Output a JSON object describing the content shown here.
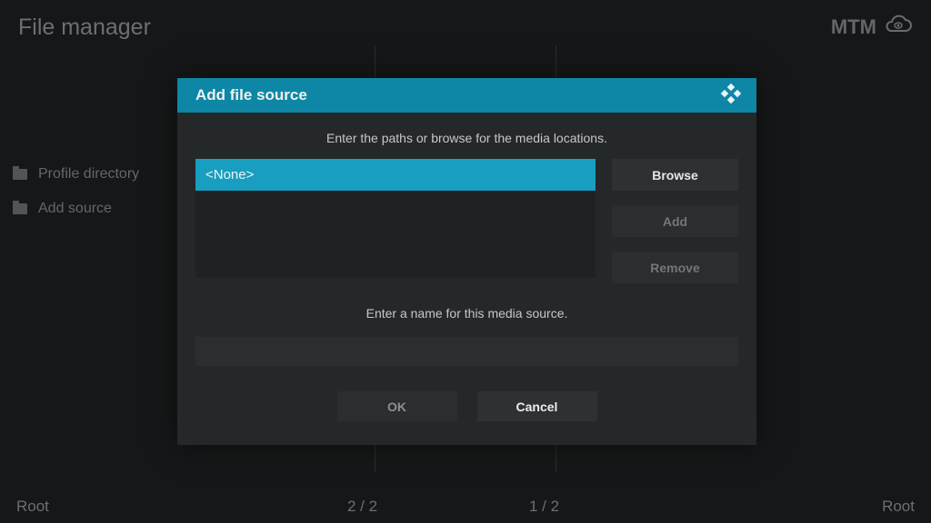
{
  "header": {
    "title": "File manager",
    "mtm": "MTM"
  },
  "sidebar": {
    "items": [
      {
        "label": "Profile directory"
      },
      {
        "label": "Add source"
      }
    ]
  },
  "footer": {
    "left": "Root",
    "countA": "2 / 2",
    "countB": "1 / 2",
    "right": "Root"
  },
  "dialog": {
    "title": "Add file source",
    "instruction1": "Enter the paths or browse for the media locations.",
    "path_value": "<None>",
    "buttons": {
      "browse": "Browse",
      "add": "Add",
      "remove": "Remove"
    },
    "instruction2": "Enter a name for this media source.",
    "name_value": "",
    "ok": "OK",
    "cancel": "Cancel"
  }
}
